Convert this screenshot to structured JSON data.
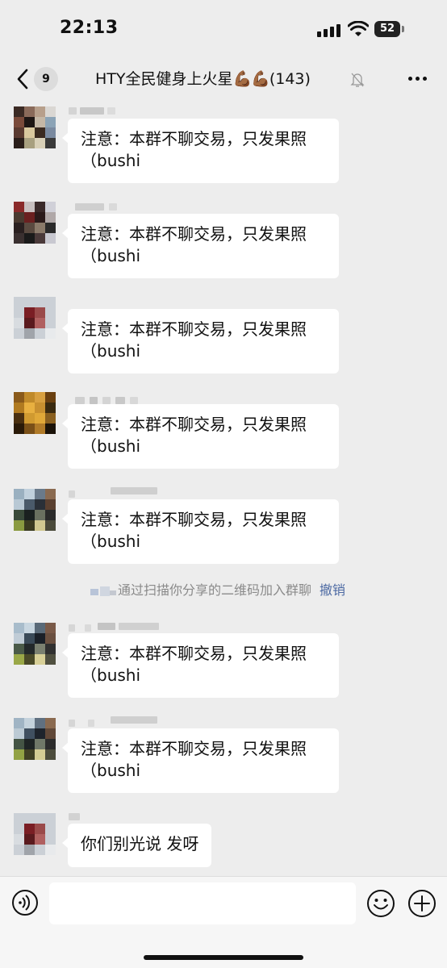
{
  "status_bar": {
    "time": "22:13",
    "battery": "52"
  },
  "nav": {
    "unread_count": "9",
    "group_name": "HTY全民健身上火星",
    "group_emoji": "💪🏾💪🏾",
    "member_count": "(143)"
  },
  "messages": [
    {
      "text_line1": "注意：本群不聊交易，只发果照",
      "text_line2": "（bushi"
    },
    {
      "text_line1": "注意：本群不聊交易，只发果照",
      "text_line2": "（bushi"
    },
    {
      "text_line1": "注意：本群不聊交易，只发果照",
      "text_line2": "（bushi"
    },
    {
      "text_line1": "注意：本群不聊交易，只发果照",
      "text_line2": "（bushi"
    },
    {
      "text_line1": "注意：本群不聊交易，只发果照",
      "text_line2": "（bushi"
    },
    {
      "text_line1": "注意：本群不聊交易，只发果照",
      "text_line2": "（bushi"
    },
    {
      "text_line1": "注意：本群不聊交易，只发果照",
      "text_line2": "（bushi"
    },
    {
      "text_line1": "你们别光说 发呀",
      "text_line2": ""
    }
  ],
  "system_notice": {
    "text": "通过扫描你分享的二维码加入群聊",
    "action": "撤销"
  },
  "colors": {
    "background": "#ededed",
    "bubble": "#ffffff",
    "link": "#4d6aa3"
  },
  "icons": {
    "back": "chevron-left-icon",
    "mute": "bell-slash-icon",
    "more": "more-icon",
    "voice": "voice-icon",
    "emoji": "emoji-icon",
    "plus": "plus-icon"
  }
}
